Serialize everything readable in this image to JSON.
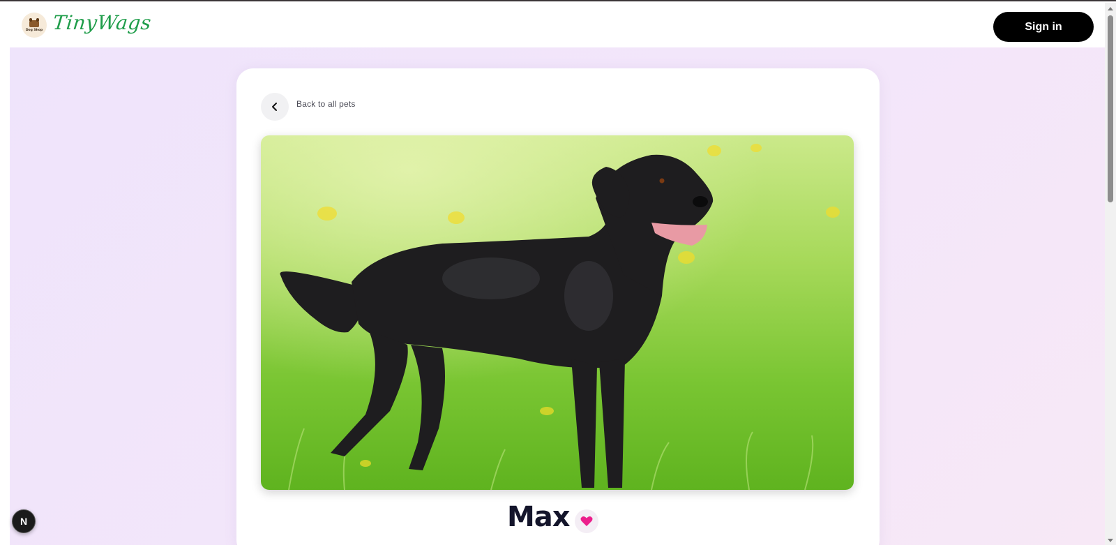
{
  "header": {
    "logo_badge_text": "Dog Shop",
    "brand": "TinyWags",
    "signin_label": "Sign in"
  },
  "pet": {
    "back_label": "Back to all pets",
    "name": "Max",
    "favorited": true
  },
  "devtools": {
    "badge_letter": "N"
  },
  "colors": {
    "brand_green": "#1f9d4a",
    "page_background": "#f1e5fa",
    "heart": "#ec1f8c",
    "signin_bg": "#000000"
  },
  "icons": {
    "back": "chevron-left-icon",
    "favorite": "heart-icon"
  }
}
